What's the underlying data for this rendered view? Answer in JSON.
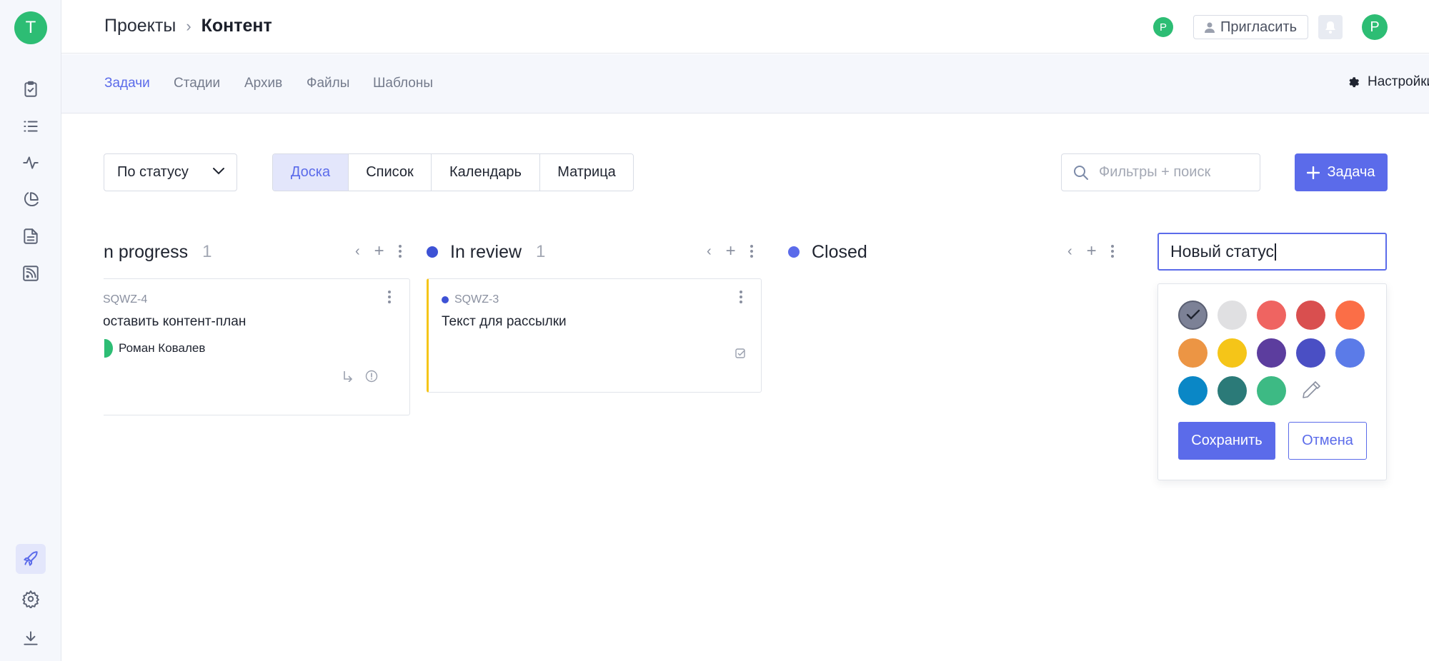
{
  "sidebar": {
    "avatar_letter": "T",
    "items": [
      {
        "icon": "clipboard-check-icon"
      },
      {
        "icon": "list-icon"
      },
      {
        "icon": "activity-icon"
      },
      {
        "icon": "pie-chart-icon"
      },
      {
        "icon": "document-icon"
      },
      {
        "icon": "rss-icon"
      }
    ],
    "bottom": [
      {
        "icon": "rocket-icon",
        "active": true
      },
      {
        "icon": "gear-icon"
      },
      {
        "icon": "download-icon"
      }
    ]
  },
  "header": {
    "breadcrumb_root": "Проекты",
    "breadcrumb_sep": "›",
    "breadcrumb_current": "Контент",
    "presence_avatar": "P",
    "invite_label": "Пригласить",
    "user_avatar": "P"
  },
  "subnav": {
    "tabs": [
      "Задачи",
      "Стадии",
      "Архив",
      "Файлы",
      "Шаблоны"
    ],
    "active_tab": "Задачи",
    "settings_label": "Настройки"
  },
  "toolbar": {
    "group_by": "По статусу",
    "views": [
      "Доска",
      "Список",
      "Календарь",
      "Матрица"
    ],
    "active_view": "Доска",
    "search_placeholder": "Фильтры + поиск",
    "add_task_label": "Задача"
  },
  "columns": [
    {
      "title": "n progress",
      "count": "1",
      "cards": [
        {
          "id": "SQWZ-4",
          "title": "оставить контент-план",
          "assignee": "Роман Ковалев"
        }
      ]
    },
    {
      "title": "In review",
      "count": "1",
      "dot_color": "#3d52d5",
      "cards": [
        {
          "id": "SQWZ-3",
          "title": "Текст для рассылки",
          "accent": "#f5c518",
          "dot_color": "#3d52d5"
        }
      ]
    },
    {
      "title": "Closed",
      "count": "",
      "dot_color": "#5b6bea",
      "cards": []
    }
  ],
  "new_status": {
    "value": "Новый статус",
    "colors": [
      "#7c8196",
      "#e0e0e2",
      "#ef6461",
      "#d94f4f",
      "#fb6e47",
      "#ec9544",
      "#f5c518",
      "#5c3d9e",
      "#4a4fc4",
      "#5b7be8",
      "#0a87c6",
      "#2b7a78",
      "#3dba84"
    ],
    "selected_color": "#7c8196",
    "save_label": "Сохранить",
    "cancel_label": "Отмена"
  },
  "colors": {
    "accent": "#5b6bea",
    "green": "#2dbd74"
  }
}
